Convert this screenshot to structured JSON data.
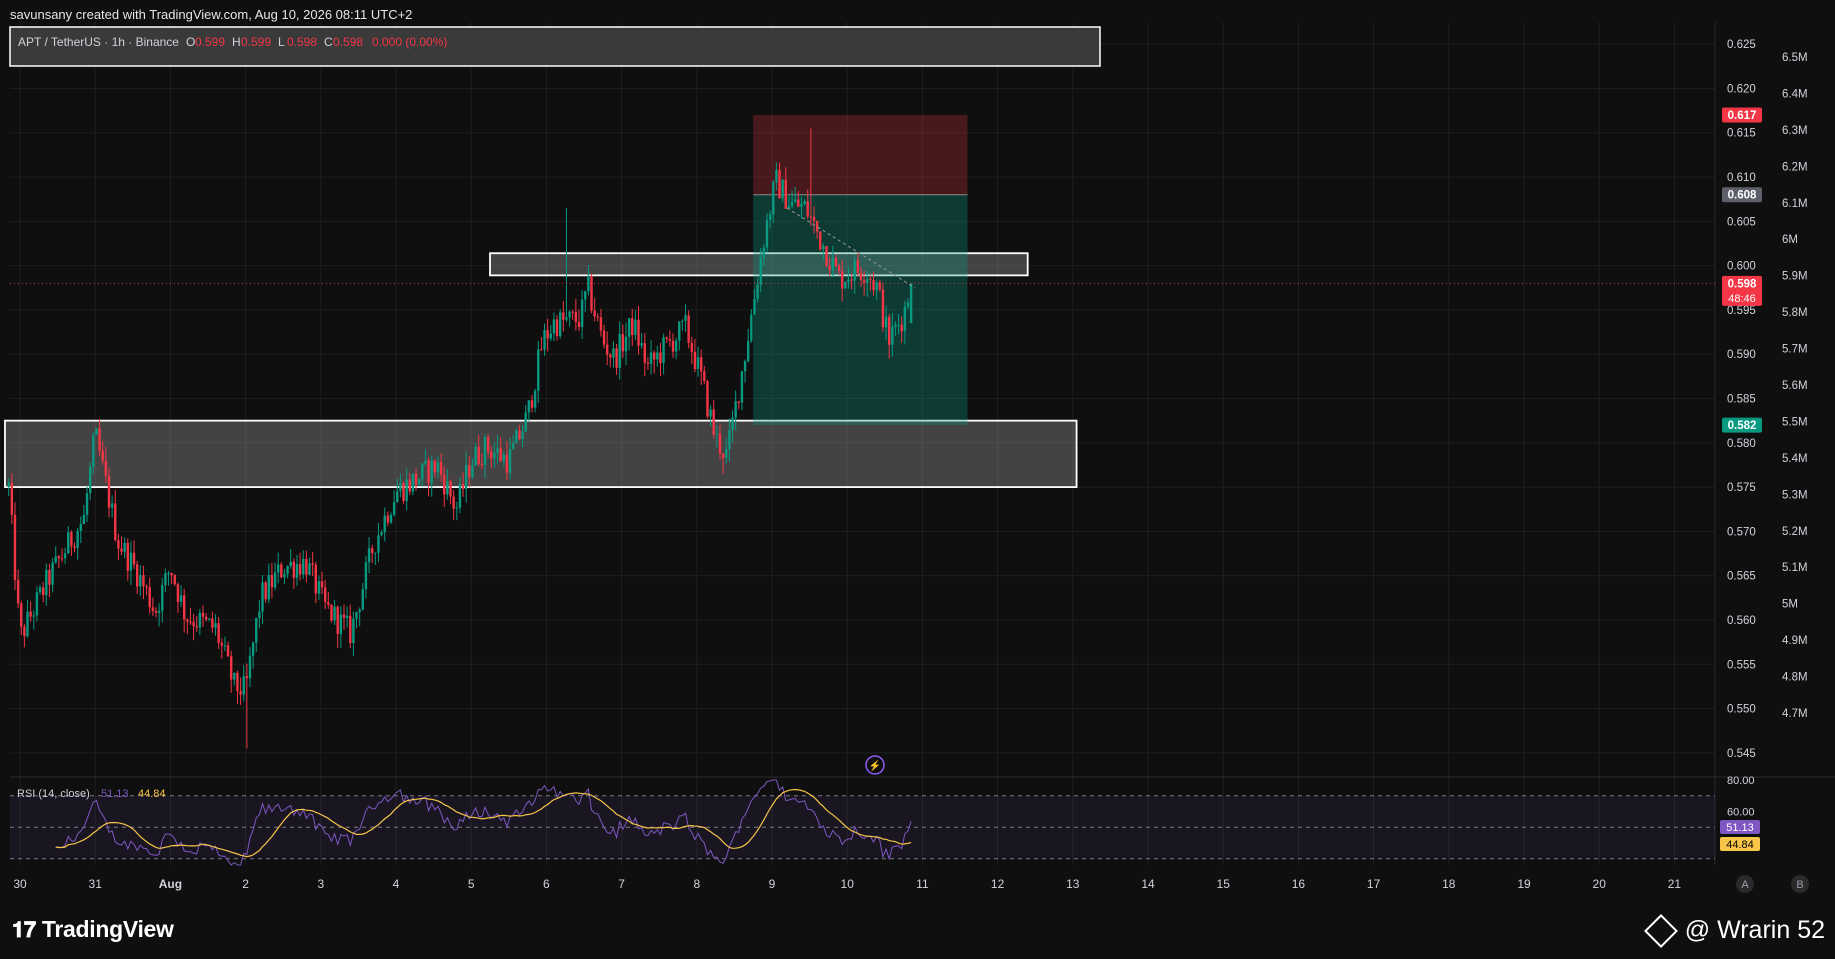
{
  "header": {
    "credit": "savunsany created with TradingView.com, Aug 10, 2026 08:11 UTC+2",
    "symbol": "APT / TetherUS · 1h · Binance",
    "ohlc": [
      {
        "k": "O",
        "v": "0.599"
      },
      {
        "k": "H",
        "v": "0.599"
      },
      {
        "k": "L",
        "v": "0.598"
      },
      {
        "k": "C",
        "v": "0.598"
      }
    ],
    "change": "0.000 (0.00%)"
  },
  "chart_data": {
    "type": "candlestick",
    "price_axis": {
      "range": [
        0.5425,
        0.6275
      ],
      "ticks": [
        "0.625",
        "0.620",
        "0.615",
        "0.610",
        "0.605",
        "0.600",
        "0.595",
        "0.590",
        "0.585",
        "0.580",
        "0.575",
        "0.570",
        "0.565",
        "0.560",
        "0.555",
        "0.550",
        "0.545"
      ],
      "tick_values": [
        0.625,
        0.62,
        0.615,
        0.61,
        0.605,
        0.6,
        0.595,
        0.59,
        0.585,
        0.58,
        0.575,
        0.57,
        0.565,
        0.56,
        0.555,
        0.55,
        0.545
      ]
    },
    "volume_axis": {
      "ticks": [
        "6.5M",
        "6.4M",
        "6.3M",
        "6.2M",
        "6.1M",
        "6M",
        "5.9M",
        "5.8M",
        "5.7M",
        "5.6M",
        "5.5M",
        "5.4M",
        "5.3M",
        "5.2M",
        "5.1M",
        "5M",
        "4.9M",
        "4.8M",
        "4.7M"
      ]
    },
    "time_axis": {
      "labels": [
        "30",
        "31",
        "Aug",
        "2",
        "3",
        "4",
        "5",
        "6",
        "7",
        "8",
        "9",
        "10",
        "11",
        "12",
        "13",
        "14",
        "15",
        "16",
        "17",
        "18",
        "19",
        "20",
        "21"
      ],
      "day_index": [
        0,
        1,
        2,
        3,
        4,
        5,
        6,
        7,
        8,
        9,
        10,
        11,
        12,
        13,
        14,
        15,
        16,
        17,
        18,
        19,
        20,
        21,
        22
      ]
    },
    "price_markers": [
      {
        "label": "0.617",
        "value": 0.617,
        "color": "#f23645"
      },
      {
        "label": "0.608",
        "value": 0.608,
        "color": "#5d606b"
      },
      {
        "label": "0.598",
        "sub": "48:46",
        "value": 0.598,
        "color": "#f23645"
      },
      {
        "label": "0.582",
        "value": 0.582,
        "color": "#089981"
      }
    ],
    "zones": [
      {
        "from_day": -0.2,
        "to_day": 14.05,
        "low": 0.575,
        "high": 0.5825
      },
      {
        "from_day": 6.25,
        "to_day": 13.4,
        "low": 0.5989,
        "high": 0.6014
      }
    ],
    "short_position": {
      "from_day": 9.75,
      "to_day": 12.6,
      "entry": 0.608,
      "stop": 0.617,
      "target": 0.582
    },
    "anchors": [
      {
        "d": -0.15,
        "p": 0.575
      },
      {
        "d": 0.0,
        "p": 0.558
      },
      {
        "d": 0.4,
        "p": 0.565
      },
      {
        "d": 0.85,
        "p": 0.5715
      },
      {
        "d": 1.0,
        "p": 0.581
      },
      {
        "d": 1.3,
        "p": 0.569
      },
      {
        "d": 1.55,
        "p": 0.5655
      },
      {
        "d": 1.8,
        "p": 0.561
      },
      {
        "d": 2.0,
        "p": 0.566
      },
      {
        "d": 2.2,
        "p": 0.5605
      },
      {
        "d": 2.6,
        "p": 0.559
      },
      {
        "d": 2.85,
        "p": 0.5525
      },
      {
        "d": 3.0,
        "p": 0.552
      },
      {
        "d": 3.2,
        "p": 0.5625
      },
      {
        "d": 3.5,
        "p": 0.566
      },
      {
        "d": 3.8,
        "p": 0.5665
      },
      {
        "d": 4.05,
        "p": 0.5615
      },
      {
        "d": 4.4,
        "p": 0.5585
      },
      {
        "d": 4.7,
        "p": 0.5685
      },
      {
        "d": 5.0,
        "p": 0.5745
      },
      {
        "d": 5.2,
        "p": 0.5755
      },
      {
        "d": 5.55,
        "p": 0.5775
      },
      {
        "d": 5.8,
        "p": 0.5725
      },
      {
        "d": 6.0,
        "p": 0.578
      },
      {
        "d": 6.2,
        "p": 0.5795
      },
      {
        "d": 6.5,
        "p": 0.578
      },
      {
        "d": 6.75,
        "p": 0.583
      },
      {
        "d": 6.95,
        "p": 0.5915
      },
      {
        "d": 7.1,
        "p": 0.5935
      },
      {
        "d": 7.45,
        "p": 0.594
      },
      {
        "d": 7.55,
        "p": 0.5975
      },
      {
        "d": 7.75,
        "p": 0.5915
      },
      {
        "d": 7.9,
        "p": 0.5895
      },
      {
        "d": 8.15,
        "p": 0.5935
      },
      {
        "d": 8.35,
        "p": 0.5885
      },
      {
        "d": 8.55,
        "p": 0.5905
      },
      {
        "d": 8.85,
        "p": 0.593
      },
      {
        "d": 9.05,
        "p": 0.5875
      },
      {
        "d": 9.25,
        "p": 0.5805
      },
      {
        "d": 9.4,
        "p": 0.5785
      },
      {
        "d": 9.65,
        "p": 0.5905
      },
      {
        "d": 9.9,
        "p": 0.6035
      },
      {
        "d": 10.05,
        "p": 0.6095
      },
      {
        "d": 10.25,
        "p": 0.607
      },
      {
        "d": 10.45,
        "p": 0.6065
      },
      {
        "d": 10.7,
        "p": 0.602
      },
      {
        "d": 10.9,
        "p": 0.5985
      },
      {
        "d": 11.1,
        "p": 0.5995
      },
      {
        "d": 11.25,
        "p": 0.5995
      },
      {
        "d": 11.4,
        "p": 0.5975
      },
      {
        "d": 11.55,
        "p": 0.5915
      },
      {
        "d": 11.75,
        "p": 0.5945
      },
      {
        "d": 11.85,
        "p": 0.598
      }
    ],
    "indicator": {
      "name": "RSI (14, close)",
      "rsi_value": "51.13",
      "ma_value": "44.84",
      "ticks": [
        "80.00",
        "60.00"
      ],
      "levels": {
        "upper": 70,
        "middle": 50,
        "lower": 30
      },
      "range": [
        26,
        80
      ],
      "rsi_color": "#7e57c2",
      "ma_color": "#f7c548"
    },
    "colors": {
      "up": "#089981",
      "down": "#f23645",
      "background": "#0f0f0f",
      "grid": "#1e1e1e"
    }
  },
  "footer": {
    "brand": "TradingView",
    "watermark": "@ Wrarin 52",
    "scale_buttons": [
      "A",
      "B"
    ]
  }
}
